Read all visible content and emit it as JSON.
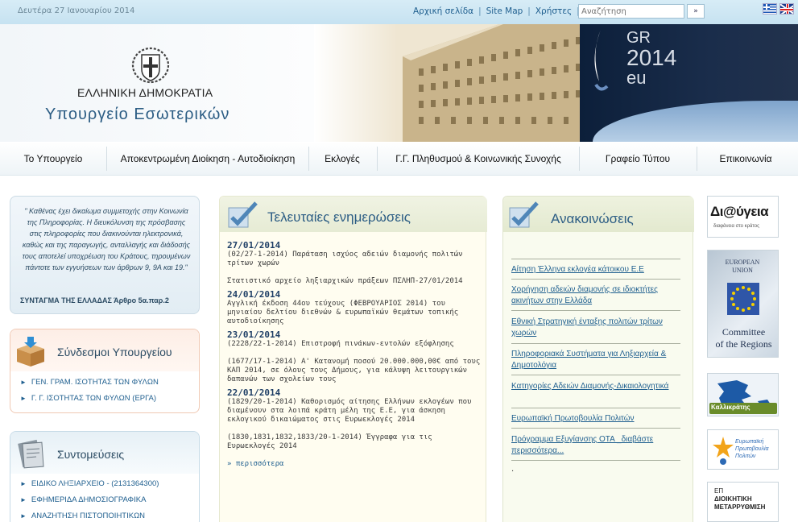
{
  "topbar": {
    "date": "Δευτέρα 27 Ιανουαρίου 2014",
    "links": [
      "Αρχική σελίδα",
      "Site Map",
      "Χρήστες"
    ],
    "search_placeholder": "Αναζήτηση",
    "search_button": "»"
  },
  "header": {
    "title": "ΕΛΛΗΝΙΚΗ ΔΗΜΟΚΡΑΤΙΑ",
    "subtitle": "Υπουργείο Εσωτερικών",
    "presidency": {
      "line1": "GR",
      "line2": "2014",
      "line3": "eu"
    }
  },
  "nav": [
    "Το Υπουργείο",
    "Αποκεντρωμένη Διοίκηση - Αυτοδιοίκηση",
    "Εκλογές",
    "Γ.Γ. Πληθυσμού & Κοινωνικής Συνοχής",
    "Γραφείο Τύπου",
    "Επικοινωνία"
  ],
  "quote": {
    "text": "\" Καθένας έχει δικαίωμα συμμετοχής στην Κοινωνία της Πληροφορίας. Η διευκόλυνση της πρόσβασης στις πληροφορίες που διακινούνται ηλεκτρονικά, καθώς και της παραγωγής, ανταλλαγής και διάδοσής τους αποτελεί υποχρέωση του Κράτους, τηρουμένων πάντοτε των εγγυήσεων των άρθρων 9, 9Α και 19.\"",
    "source": "ΣΥΝΤΑΓΜΑ ΤΗΣ ΕΛΛΑΔΑΣ Άρθρο 5α.παρ.2"
  },
  "links_box": {
    "title": "Σύνδεσμοι Υπουργείου",
    "items": [
      "ΓΕΝ. ΓΡΑΜ. ΙΣΟΤΗΤΑΣ ΤΩΝ ΦΥΛΩΝ",
      "Γ. Γ. ΙΣΟΤΗΤΑΣ ΤΩΝ ΦΥΛΩΝ (ΕΡΓΑ)"
    ]
  },
  "shortcuts_box": {
    "title": "Συντομεύσεις",
    "items": [
      "ΕΙΔΙΚΟ ΛΗΞΙΑΡΧΕΙΟ - (2131364300)",
      "ΕΦΗΜΕΡΙΔΑ ΔΗΜΟΣΙΟΓΡΑΦΙΚΑ",
      "ΑΝΑΖΗΤΗΣΗ ΠΙΣΤΟΠΟΙΗΤΙΚΩΝ"
    ]
  },
  "news": {
    "title": "Τελευταίες ενημερώσεις",
    "items": [
      {
        "date": "27/01/2014",
        "texts": [
          "(02/27-1-2014) Παράταση ισχύος αδειών διαμονής πολιτών τρίτων χωρών",
          "Στατιστικό αρχείο ληξιαρχικών πράξεων ΠΣΛΗΠ-27/01/2014"
        ]
      },
      {
        "date": "24/01/2014",
        "texts": [
          "Αγγλική έκδοση 44ου τεύχους (ΦΕΒΡΟΥΑΡΙΟΣ 2014) του μηνιαίου δελτίου διεθνών & ευρωπαϊκών θεμάτων τοπικής αυτοδιοίκησης"
        ]
      },
      {
        "date": "23/01/2014",
        "texts": [
          "(2228/22-1-2014) Επιστροφή πινάκων-εντολών εξόφλησης",
          "(1677/17-1-2014) Α' Κατανομή ποσού 20.000.000,00€ από τους ΚΑΠ 2014, σε όλους τους Δήμους, για κάλυψη λειτουργικών δαπανών των σχολείων τους"
        ]
      },
      {
        "date": "22/01/2014",
        "texts": [
          "(1829/20-1-2014) Καθορισμός αίτησης Ελλήνων εκλογέων που διαμένουν στα λοιπά κράτη μέλη της Ε.Ε, για άσκηση εκλογικού δικαιώματος στις Ευρωεκλογές 2014",
          "(1830,1831,1832,1833/20-1-2014) Έγγραφα για τις Ευρωεκλογές 2014"
        ]
      }
    ],
    "more": "» περισσότερα"
  },
  "announcements": {
    "title": "Ανακοινώσεις",
    "items": [
      "Αίτηση Έλληνα εκλογέα κάτοικου Ε.Ε",
      "Χορήγηση αδειών διαμονής σε ιδιοκτήτες ακινήτων στην Ελλάδα",
      "Εθνική Στρατηγική ένταξης πολιτών τρίτων χωρών",
      "Πληροφοριακά Συστήματα για Ληξιαρχεία & Δημοτολόγια",
      "Κατηγορίες Αδειών Διαμονής-Δικαιολογητικά",
      "Ευρωπαϊκή Πρωτοβουλία Πολιτών",
      "Πρόγραμμα Εξυγίανσης ΟΤΑ _διαβάστε περισσότερα..."
    ],
    "dot": "."
  },
  "banners": {
    "diavgeia": {
      "title": "Δι@ύγεια",
      "subtitle": "διαφάνεια στο κράτος"
    },
    "cor": {
      "top": "EUROPEAN UNION",
      "bottom1": "Committee",
      "bottom2": "of the Regions"
    },
    "kallikratis": {
      "label": "Καλλικράτης"
    },
    "initiative": {
      "label": "Ευρωπαϊκή Πρωτοβουλία Πολιτών"
    },
    "admin_reform": {
      "line1": "ΕΠ",
      "line2": "ΔΙΟΙΚΗΤΙΚΗ",
      "line3": "ΜΕΤΑΡΡΥΘΜΙΣΗ"
    }
  },
  "colors": {
    "accent": "#2c5d84",
    "link": "#1f5f8f",
    "background": "#cfe6f3"
  }
}
